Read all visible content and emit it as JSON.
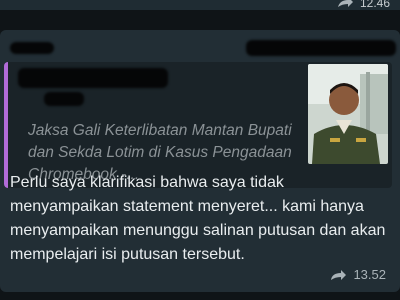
{
  "previous_message": {
    "time": "12.46"
  },
  "forwarded_message": {
    "link_preview": {
      "title": "Jaksa Gali Keterlibatan Mantan Bupati dan Sekda Lotim di Kasus Pengadaan Chromebook -...",
      "thumbnail_icon": "person-photo",
      "accent_color": "#b16bd8"
    },
    "text": "Perlu saya klarifikasi bahwa saya tidak menyampaikan statement menyeret... kami hanya menyampaikan menunggu salinan putusan dan akan mempelajari isi putusan tersebut.",
    "time": "13.52",
    "share_icon": "forward-arrow-icon"
  }
}
